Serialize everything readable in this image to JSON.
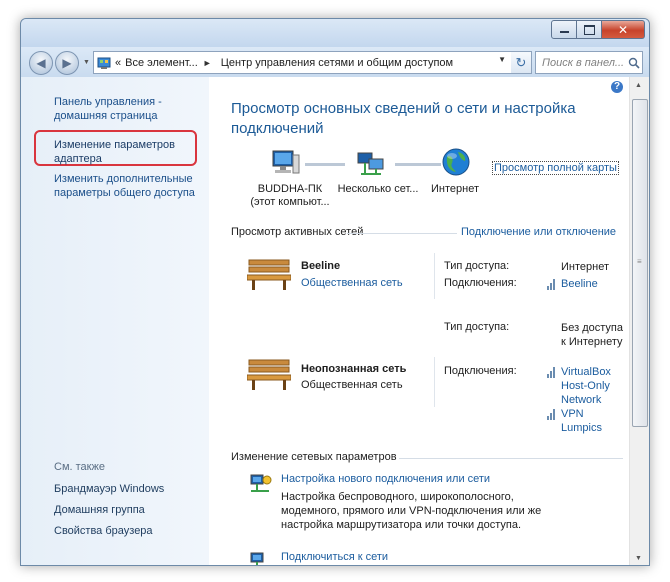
{
  "window": {
    "caption_buttons": {
      "minimize": "minimize-icon",
      "maximize": "maximize-icon",
      "close": "✕"
    }
  },
  "navbar": {
    "back_glyph": "◀",
    "forward_glyph": "▶",
    "address": {
      "overflow": "«",
      "crumb1": "Все элемент...",
      "separator": "►",
      "crumb2": "Центр управления сетями и общим доступом",
      "dropdown_glyph": "▼"
    },
    "refresh_glyph": "↻",
    "search_placeholder": "Поиск в панел..."
  },
  "sidebar": {
    "home_link": "Панель управления - домашняя страница",
    "adapter_link": "Изменение параметров адаптера",
    "sharing_link": "Изменить дополнительные параметры общего доступа",
    "see_also": "См. также",
    "items": [
      "Брандмауэр Windows",
      "Домашняя группа",
      "Свойства браузера"
    ]
  },
  "main": {
    "help": "?",
    "title": "Просмотр основных сведений о сети и настройка подключений",
    "map": {
      "computer_name": "BUDDHA-ПК",
      "computer_sub": "(этот компьют...",
      "networks": "Несколько сет...",
      "internet": "Интернет",
      "full_map_link": "Просмотр полной карты"
    },
    "active_networks_label": "Просмотр активных сетей",
    "connect_disconnect_link": "Подключение или отключение",
    "networks": [
      {
        "name": "Beeline",
        "type": "Общественная сеть",
        "access_label": "Тип доступа:",
        "access_value": "Интернет",
        "connections_label": "Подключения:",
        "connection": "Beeline"
      },
      {
        "name": "Неопознанная сеть",
        "type": "Общественная сеть",
        "access_label": "Тип доступа:",
        "access_value": "Без доступа к Интернету",
        "connections_label": "Подключения:",
        "connection1": "VirtualBox Host-Only Network",
        "connection2": "VPN Lumpics"
      }
    ],
    "change_settings_label": "Изменение сетевых параметров",
    "tasks": [
      {
        "link": "Настройка нового подключения или сети",
        "desc": "Настройка беспроводного, широкополосного, модемного, прямого или VPN-подключения или же настройка маршрутизатора или точки доступа."
      },
      {
        "link": "Подключиться к сети",
        "desc": ""
      }
    ]
  },
  "colors": {
    "link": "#1b5c9e",
    "title": "#1c5a96",
    "highlight_box": "#d9353e",
    "sidebar_bg": "#e9f1fa"
  }
}
